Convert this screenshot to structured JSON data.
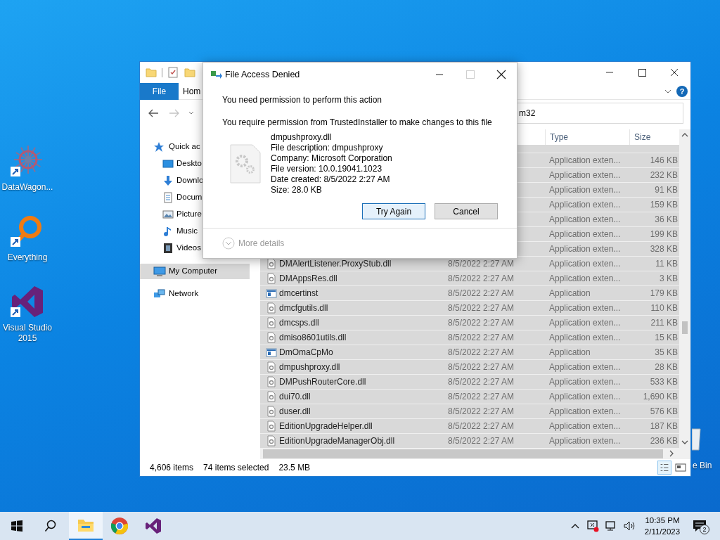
{
  "desktop_icons": [
    {
      "kind": "starburst",
      "label": "DataWagon..."
    },
    {
      "kind": "magnifier",
      "label": "Everything"
    },
    {
      "kind": "bowtie",
      "label": "Visual Studio 2015"
    }
  ],
  "recycle_bin": {
    "label": "e Bin"
  },
  "explorer": {
    "ribbon_tabs": [
      {
        "kind": "file_menu",
        "label": "File"
      },
      {
        "kind": "tab",
        "label": "Hom"
      }
    ],
    "help": {
      "label": "?"
    },
    "address": "m32",
    "nav": [
      {
        "kind": "star",
        "label": "Quick ac",
        "selected": false,
        "children": [
          {
            "kind": "desktop",
            "label": "Deskto",
            "selected": false
          },
          {
            "kind": "download",
            "label": "Downlo",
            "selected": false
          },
          {
            "kind": "document",
            "label": "Docum",
            "selected": false
          },
          {
            "kind": "picture",
            "label": "Picture",
            "selected": false
          },
          {
            "kind": "music",
            "label": "Music",
            "selected": false
          },
          {
            "kind": "video",
            "label": "Videos",
            "selected": false
          }
        ]
      },
      {
        "kind": "computer",
        "label": "My Computer",
        "selected": true
      },
      {
        "kind": "network",
        "label": "Network",
        "selected": false
      }
    ],
    "columns": [
      "Type",
      "Size"
    ],
    "rows": [
      {
        "type": "Application exten...",
        "size": "146 KB",
        "selected": true
      },
      {
        "type": "Application exten...",
        "size": "232 KB",
        "selected": true
      },
      {
        "type": "Application exten...",
        "size": "91 KB",
        "selected": true
      },
      {
        "type": "Application exten...",
        "size": "159 KB",
        "selected": true
      },
      {
        "type": "Application exten...",
        "size": "36 KB",
        "selected": true
      },
      {
        "type": "Application exten...",
        "size": "199 KB",
        "selected": true
      },
      {
        "type": "Application exten...",
        "size": "328 KB",
        "selected": true
      },
      {
        "kind": "dll",
        "name": "DMAlertListener.ProxyStub.dll",
        "date": "8/5/2022 2:27 AM",
        "type": "Application exten...",
        "size": "11 KB",
        "selected": true
      },
      {
        "kind": "dll",
        "name": "DMAppsRes.dll",
        "date": "8/5/2022 2:27 AM",
        "type": "Application exten...",
        "size": "3 KB",
        "selected": true
      },
      {
        "kind": "exe",
        "name": "dmcertinst",
        "date": "8/5/2022 2:27 AM",
        "type": "Application",
        "size": "179 KB",
        "selected": true
      },
      {
        "kind": "dll",
        "name": "dmcfgutils.dll",
        "date": "8/5/2022 2:27 AM",
        "type": "Application exten...",
        "size": "110 KB",
        "selected": true
      },
      {
        "kind": "dll",
        "name": "dmcsps.dll",
        "date": "8/5/2022 2:27 AM",
        "type": "Application exten...",
        "size": "211 KB",
        "selected": true
      },
      {
        "kind": "dll",
        "name": "dmiso8601utils.dll",
        "date": "8/5/2022 2:27 AM",
        "type": "Application exten...",
        "size": "15 KB",
        "selected": true
      },
      {
        "kind": "exe",
        "name": "DmOmaCpMo",
        "date": "8/5/2022 2:27 AM",
        "type": "Application",
        "size": "35 KB",
        "selected": true
      },
      {
        "kind": "dll",
        "name": "dmpushproxy.dll",
        "date": "8/5/2022 2:27 AM",
        "type": "Application exten...",
        "size": "28 KB",
        "selected": true
      },
      {
        "kind": "dll",
        "name": "DMPushRouterCore.dll",
        "date": "8/5/2022 2:27 AM",
        "type": "Application exten...",
        "size": "533 KB",
        "selected": true
      },
      {
        "kind": "dll",
        "name": "dui70.dll",
        "date": "8/5/2022 2:27 AM",
        "type": "Application exten...",
        "size": "1,690 KB",
        "selected": true
      },
      {
        "kind": "dll",
        "name": "duser.dll",
        "date": "8/5/2022 2:27 AM",
        "type": "Application exten...",
        "size": "576 KB",
        "selected": true
      },
      {
        "kind": "dll",
        "name": "EditionUpgradeHelper.dll",
        "date": "8/5/2022 2:27 AM",
        "type": "Application exten...",
        "size": "187 KB",
        "selected": true
      },
      {
        "kind": "dll",
        "name": "EditionUpgradeManagerObj.dll",
        "date": "8/5/2022 2:27 AM",
        "type": "Application exten...",
        "size": "236 KB",
        "selected": true
      }
    ],
    "status": {
      "items": "4,606 items",
      "selected": "74 items selected",
      "size": "23.5 MB"
    }
  },
  "dialog": {
    "title": "File Access Denied",
    "heading": "You need permission to perform this action",
    "message": "You require permission from TrustedInstaller to make changes to this file",
    "file_lines": [
      "dmpushproxy.dll",
      "File description: dmpushproxy",
      "Company: Microsoft Corporation",
      "File version: 10.0.19041.1023",
      "Date created: 8/5/2022 2:27 AM",
      "Size: 28.0 KB"
    ],
    "buttons": [
      {
        "label": "Try Again",
        "focused": true
      },
      {
        "label": "Cancel",
        "focused": false
      }
    ],
    "more_details": "More details"
  },
  "taskbar": {
    "apps": [
      {
        "kind": "folder",
        "active": true
      },
      {
        "kind": "browser",
        "active": false
      },
      {
        "kind": "bowtie",
        "active": false
      }
    ],
    "time": "10:35 PM",
    "date": "2/11/2023",
    "notification_count": "2"
  }
}
